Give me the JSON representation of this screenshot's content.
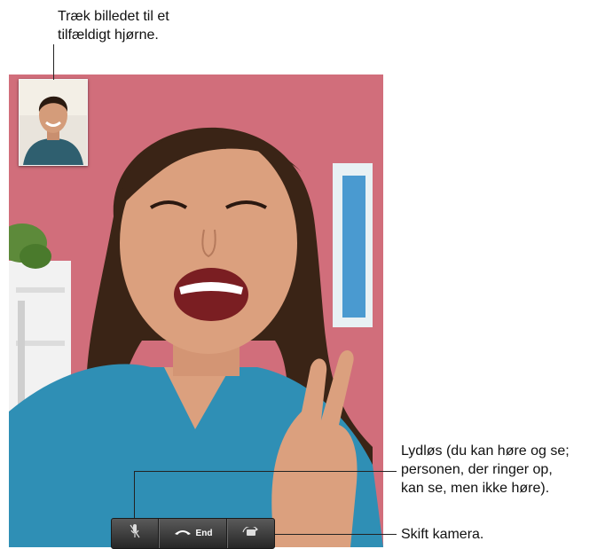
{
  "callouts": {
    "drag_pip": "Træk billedet til et\ntilfældigt hjørne.",
    "mute": "Lydløs (du kan høre og se;\npersonen, der ringer op,\nkan se, men ikke høre).",
    "switch_camera": "Skift kamera."
  },
  "controls": {
    "end_label": "End",
    "icons": {
      "mute": "microphone-muted-icon",
      "end": "phone-handset-icon",
      "switch": "camera-rotate-icon"
    }
  },
  "colors": {
    "wall": "#d4737f",
    "shirt": "#2f8fb5",
    "hair": "#3a2416",
    "skin": "#dba07e"
  }
}
